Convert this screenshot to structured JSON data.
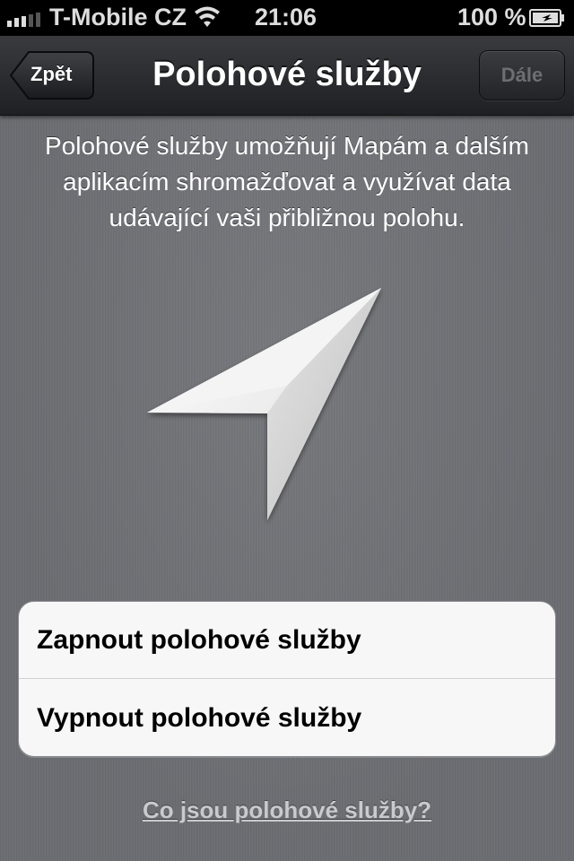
{
  "status_bar": {
    "carrier": "T-Mobile CZ",
    "time": "21:06",
    "battery_percent": "100 %",
    "signal_icon": "signal-bars-icon",
    "wifi_icon": "wifi-icon",
    "battery_icon": "battery-charging-icon"
  },
  "nav_bar": {
    "title": "Polohové služby",
    "back_label": "Zpět",
    "next_label": "Dále"
  },
  "description": "Polohové služby umožňují Mapám a dalším aplikacím shromažďovat a využívat data udávající vaši přibližnou polohu.",
  "illustration_icon": "location-arrow-icon",
  "options": [
    {
      "label": "Zapnout polohové služby"
    },
    {
      "label": "Vypnout polohové služby"
    }
  ],
  "help_link": "Co jsou polohové služby?"
}
